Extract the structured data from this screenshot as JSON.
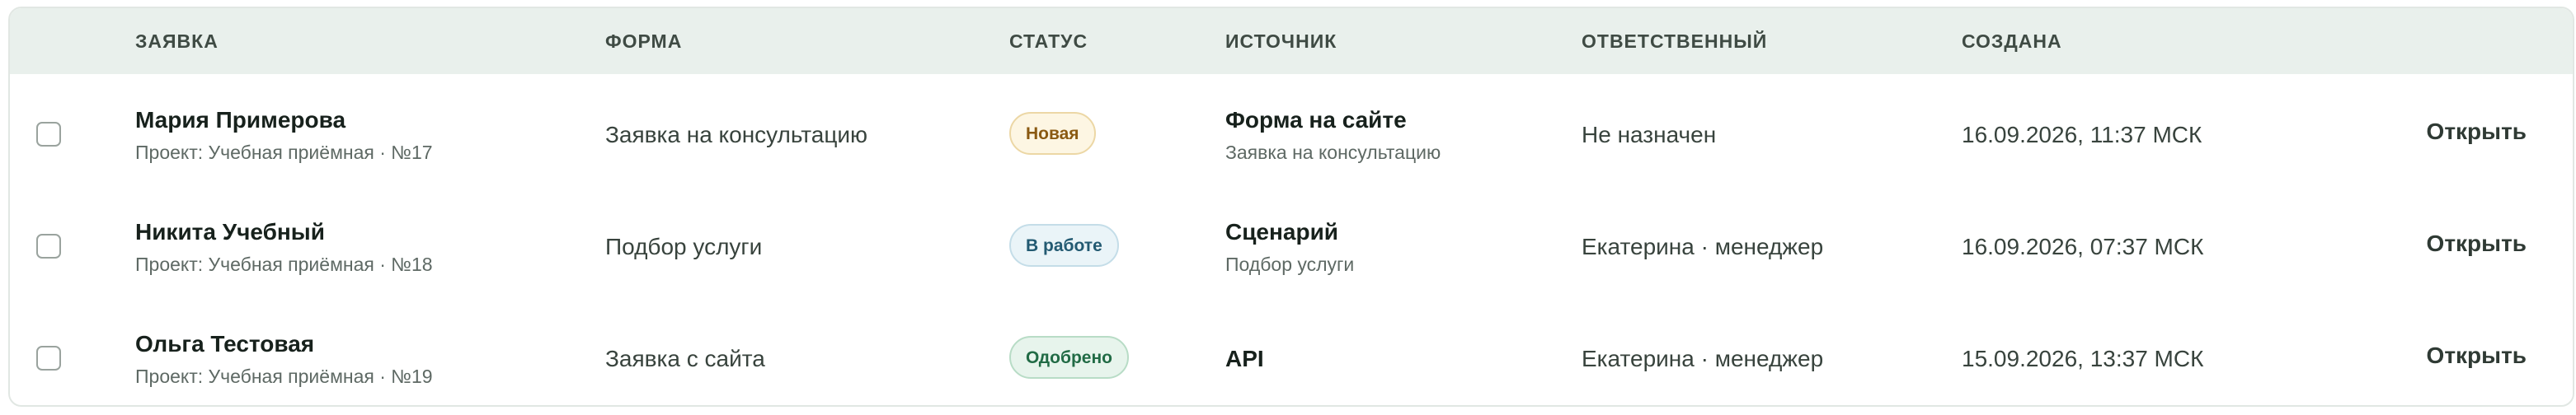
{
  "table": {
    "headers": {
      "request": "ЗАЯВКА",
      "form": "ФОРМА",
      "status": "СТАТУС",
      "source": "ИСТОЧНИК",
      "assignee": "ОТВЕТСТВЕННЫЙ",
      "created": "СОЗДАНА"
    },
    "rows": [
      {
        "name": "Мария Примерова",
        "meta": "Проект: Учебная приёмная · №17",
        "form": "Заявка на консультацию",
        "status": "Новая",
        "status_bg": "#fdf6e3",
        "status_border": "#ecd7a5",
        "status_color": "#8a5a12",
        "source_title": "Форма на сайте",
        "source_sub": "Заявка на консультацию",
        "assignee": "Не назначен",
        "created": "16.09.2026, 11:37 МСК",
        "action": "Открыть"
      },
      {
        "name": "Никита Учебный",
        "meta": "Проект: Учебная приёмная · №18",
        "form": "Подбор услуги",
        "status": "В работе",
        "status_bg": "#eaf4f8",
        "status_border": "#c4dde8",
        "status_color": "#235a72",
        "source_title": "Сценарий",
        "source_sub": "Подбор услуги",
        "assignee": "Екатерина · менеджер",
        "created": "16.09.2026, 07:37 МСК",
        "action": "Открыть"
      },
      {
        "name": "Ольга Тестовая",
        "meta": "Проект: Учебная приёмная · №19",
        "form": "Заявка с сайта",
        "status": "Одобрено",
        "status_bg": "#e7f4ec",
        "status_border": "#b8dcc6",
        "status_color": "#216b45",
        "source_title": "API",
        "source_sub": "",
        "assignee": "Екатерина · менеджер",
        "created": "15.09.2026, 13:37 МСК",
        "action": "Открыть"
      }
    ]
  }
}
